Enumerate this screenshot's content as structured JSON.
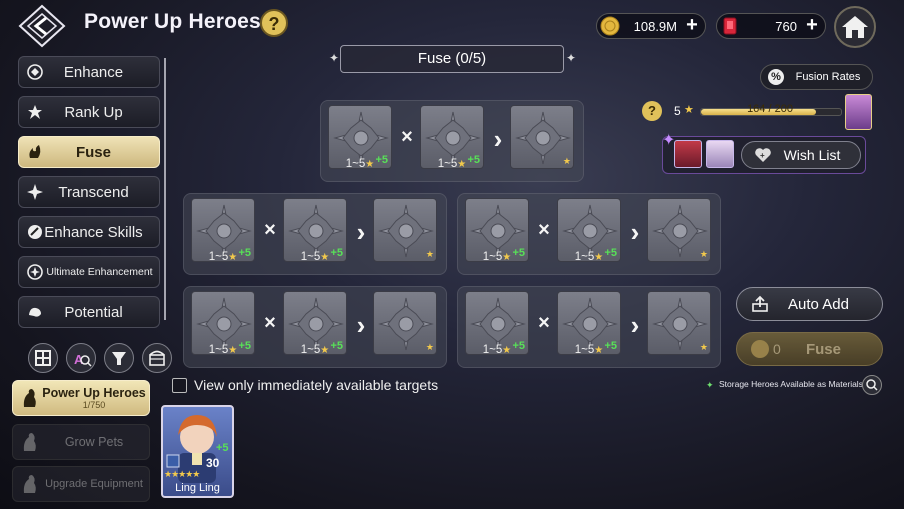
{
  "header": {
    "title": "Power Up Heroes",
    "help": "?"
  },
  "currency": {
    "gold": "108.9M",
    "gems": "760",
    "plus": "+"
  },
  "menu": [
    {
      "label": "Enhance",
      "icon": "enhance-icon"
    },
    {
      "label": "Rank Up",
      "icon": "rank-up-icon"
    },
    {
      "label": "Fuse",
      "icon": "fuse-icon",
      "active": true
    },
    {
      "label": "Transcend",
      "icon": "transcend-icon"
    },
    {
      "label": "Enhance Skills",
      "icon": "enhance-skills-icon"
    },
    {
      "label": "Ultimate Enhancement",
      "icon": "ultimate-enhancement-icon"
    },
    {
      "label": "Potential",
      "icon": "potential-icon"
    }
  ],
  "filters": [
    "grid-view-icon",
    "search-hero-icon",
    "filter-icon",
    "inventory-chest-icon"
  ],
  "sub_nav": [
    {
      "label": "Power Up Heroes",
      "count": "1/750",
      "active": true
    },
    {
      "label": "Grow Pets",
      "count": ""
    },
    {
      "label": "Upgrade Equipment",
      "count": ""
    }
  ],
  "fuse": {
    "tab_label": "Fuse (0/5)",
    "recipes": [
      {
        "left_range": "1~5",
        "right_range": "1~5",
        "plus": "+5"
      },
      {
        "left_range": "1~5",
        "right_range": "1~5",
        "plus": "+5"
      },
      {
        "left_range": "1~5",
        "right_range": "1~5",
        "plus": "+5"
      },
      {
        "left_range": "1~5",
        "right_range": "1~5",
        "plus": "+5"
      },
      {
        "left_range": "1~5",
        "right_range": "1~5",
        "plus": "+5"
      }
    ],
    "times": "×",
    "arrow": "›"
  },
  "fusion_rates": {
    "icon": "%",
    "label": "Fusion Rates"
  },
  "level": {
    "help": "?",
    "level": "5",
    "current": 164,
    "max": 200,
    "text": "164 / 200",
    "progress": 0.82
  },
  "wishlist": {
    "label": "Wish List"
  },
  "actions": {
    "auto_add": "Auto Add",
    "fuse": "Fuse",
    "fuse_cost": "0"
  },
  "storage_note": "Storage Heroes Available as Materials",
  "filter_checkbox": "View only immediately available targets",
  "hero": {
    "name": "Ling Ling",
    "plus": "+5",
    "level": "30",
    "stars": "★★★★★"
  }
}
